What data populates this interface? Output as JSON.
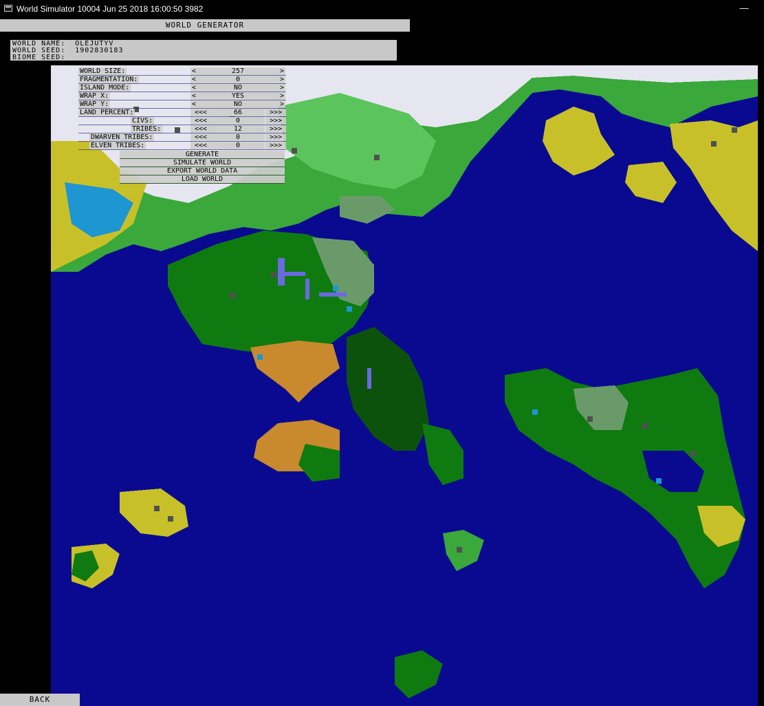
{
  "window": {
    "title": "World Simulator 10004 Jun 25 2018 16:00:50 3982",
    "minimize_label": "—"
  },
  "header": {
    "title": "WORLD GENERATOR"
  },
  "world_info": {
    "name_line": "WORLD NAME:  OLEJUTYV",
    "seed_line": "WORLD SEED:  1902830183",
    "biome_seed_line": "BIOME SEED:"
  },
  "settings": {
    "world_size": {
      "label": "WORLD SIZE:",
      "value": "257",
      "dec": "<",
      "inc": ">"
    },
    "fragmentation": {
      "label": "FRAGMENTATION:",
      "value": "0",
      "dec": "<",
      "inc": ">"
    },
    "island_mode": {
      "label": "ISLAND MODE:",
      "value": "NO",
      "dec": "<",
      "inc": ">"
    },
    "wrap_x": {
      "label": "WRAP X:",
      "value": "YES",
      "dec": "<",
      "inc": ">"
    },
    "wrap_y": {
      "label": "WRAP Y:",
      "value": "NO",
      "dec": "<",
      "inc": ">"
    },
    "land_percent": {
      "label": "LAND PERCENT:",
      "value": "66",
      "dec": "<<<",
      "inc": ">>>"
    },
    "civs": {
      "label": "CIVS:",
      "value": "0",
      "dec": "<<<",
      "inc": ">>>"
    },
    "tribes": {
      "label": "TRIBES:",
      "value": "12",
      "dec": "<<<",
      "inc": ">>>"
    },
    "dwarven_tribes": {
      "label": "DWARVEN TRIBES:",
      "value": "0",
      "dec": "<<<",
      "inc": ">>>"
    },
    "elven_tribes": {
      "label": "ELVEN TRIBES:",
      "value": "0",
      "dec": "<<<",
      "inc": ">>>"
    }
  },
  "actions": {
    "generate": "GENERATE",
    "simulate": "SIMULATE WORLD",
    "export": "EXPORT WORLD DATA",
    "load": "LOAD WORLD"
  },
  "footer": {
    "back": "BACK"
  },
  "map_colors": {
    "ocean": "#0a0a91",
    "forest": "#0f7a0f",
    "grassland": "#3aa83a",
    "light_grass": "#5cc45c",
    "dark_forest": "#0c520c",
    "desert": "#c88a2c",
    "savanna": "#c8c028",
    "snow": "#e6e6f0",
    "mountain": "#505050",
    "lake": "#1e96d2",
    "river": "#6a6ae0",
    "sage": "#6a9a6a"
  }
}
